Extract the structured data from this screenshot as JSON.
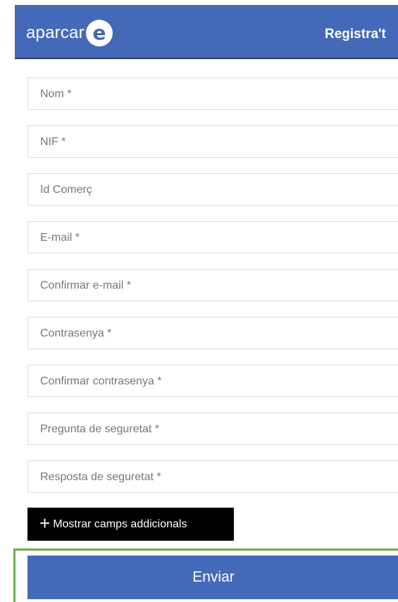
{
  "header": {
    "logo_text": "aparcar",
    "logo_mark": "e",
    "title": "Registra't"
  },
  "form": {
    "fields": [
      {
        "placeholder": "Nom *"
      },
      {
        "placeholder": "NIF *"
      },
      {
        "placeholder": "Id Comerç"
      },
      {
        "placeholder": "E-mail *"
      },
      {
        "placeholder": "Confirmar e-mail *"
      },
      {
        "placeholder": "Contrasenya *"
      },
      {
        "placeholder": "Confirmar contrasenya *"
      },
      {
        "placeholder": "Pregunta de seguretat *"
      },
      {
        "placeholder": "Resposta de seguretat *"
      }
    ],
    "more_fields_icon": "+",
    "more_fields_label": "Mostrar camps addicionals",
    "submit_label": "Enviar"
  },
  "colors": {
    "brand_blue": "#4469b8",
    "highlight_green": "#72aa4f",
    "secondary_button": "#000000"
  }
}
